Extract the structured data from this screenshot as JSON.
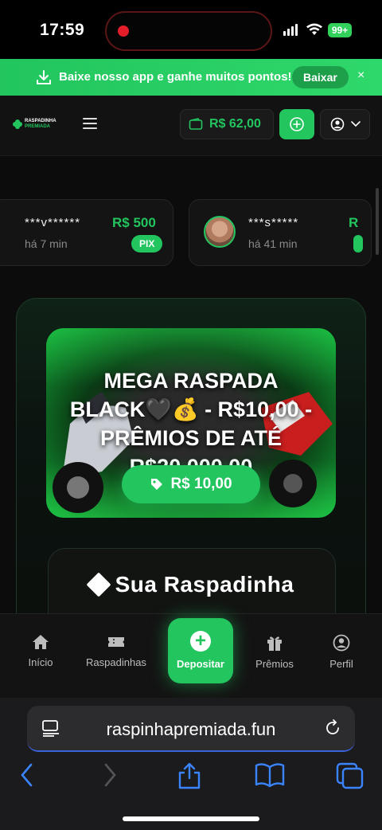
{
  "status_bar": {
    "time": "17:59",
    "battery": "99+"
  },
  "banner": {
    "text": "Baixe nosso app e ganhe muitos pontos!",
    "button": "Baixar",
    "close": "×"
  },
  "header": {
    "logo_line1": "RASPADINHA",
    "logo_line2": "PREMIADA",
    "balance": "R$ 62,00"
  },
  "winners": [
    {
      "name": "***v******",
      "time": "há 7 min",
      "prize": "R$ 500",
      "badge": "PIX"
    },
    {
      "name": "***s*****",
      "time": "há 41 min",
      "prize": "R"
    }
  ],
  "game": {
    "title": "MEGA RASPADA BLACK🖤💰 - R$10,00 - PRÊMIOS DE ATÉ R$20.000,00",
    "price": "R$ 10,00",
    "section_title": "Sua Raspadinha"
  },
  "bottom_nav": {
    "home": "Início",
    "scratch": "Raspadinhas",
    "deposit": "Depositar",
    "prizes": "Prêmios",
    "profile": "Perfil"
  },
  "browser": {
    "url": "raspinhapremiada.fun"
  },
  "colors": {
    "accent": "#22c55e",
    "background": "#0c0c0c"
  }
}
